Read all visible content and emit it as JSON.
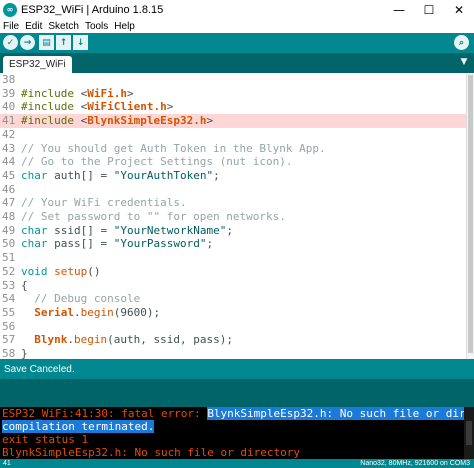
{
  "window": {
    "title": "ESP32_WiFi | Arduino 1.8.15",
    "logo_text": "∞",
    "controls": {
      "minimize": "—",
      "maximize": "☐",
      "close": "✕"
    }
  },
  "menu": [
    "File",
    "Edit",
    "Sketch",
    "Tools",
    "Help"
  ],
  "toolbar": {
    "buttons": [
      {
        "name": "verify",
        "icon": "check-icon",
        "glyph": "✓"
      },
      {
        "name": "upload",
        "icon": "arrow-right-icon",
        "glyph": "→"
      },
      {
        "name": "new",
        "icon": "new-file-icon",
        "glyph": "▤"
      },
      {
        "name": "open",
        "icon": "arrow-up-icon",
        "glyph": "↑"
      },
      {
        "name": "save",
        "icon": "arrow-down-icon",
        "glyph": "↓"
      }
    ],
    "serial_monitor_glyph": "⌕"
  },
  "tabs": [
    {
      "label": "ESP32_WiFi"
    }
  ],
  "tab_menu_glyph": "▼",
  "editor": {
    "highlighted_line": "41",
    "lines": [
      {
        "n": "38",
        "code": ""
      },
      {
        "n": "39",
        "code": "#include <WiFi.h>"
      },
      {
        "n": "40",
        "code": "#include <WiFiClient.h>"
      },
      {
        "n": "41",
        "code": "#include <BlynkSimpleEsp32.h>"
      },
      {
        "n": "42",
        "code": ""
      },
      {
        "n": "43",
        "code": "// You should get Auth Token in the Blynk App."
      },
      {
        "n": "44",
        "code": "// Go to the Project Settings (nut icon)."
      },
      {
        "n": "45",
        "code": "char auth[] = \"YourAuthToken\";"
      },
      {
        "n": "46",
        "code": ""
      },
      {
        "n": "47",
        "code": "// Your WiFi credentials."
      },
      {
        "n": "48",
        "code": "// Set password to \"\" for open networks."
      },
      {
        "n": "49",
        "code": "char ssid[] = \"YourNetworkName\";"
      },
      {
        "n": "50",
        "code": "char pass[] = \"YourPassword\";"
      },
      {
        "n": "51",
        "code": ""
      },
      {
        "n": "52",
        "code": "void setup()"
      },
      {
        "n": "53",
        "code": "{"
      },
      {
        "n": "54",
        "code": "  // Debug console"
      },
      {
        "n": "55",
        "code": "  Serial.begin(9600);"
      },
      {
        "n": "56",
        "code": ""
      },
      {
        "n": "57",
        "code": "  Blynk.begin(auth, ssid, pass);"
      },
      {
        "n": "58",
        "code": "}"
      },
      {
        "n": "59",
        "code": ""
      }
    ]
  },
  "status": {
    "message": "Save Canceled."
  },
  "console": {
    "lines": [
      {
        "segments": [
          {
            "text": "ESP32_WiFi:41:30: fatal error: ",
            "selected": false
          },
          {
            "text": "BlynkSimpleEsp32.h: No such file or directory",
            "selected": true
          }
        ]
      },
      {
        "segments": [
          {
            "text": "compilation terminated.",
            "selected": true
          }
        ]
      },
      {
        "segments": [
          {
            "text": "exit status 1",
            "selected": false
          }
        ]
      },
      {
        "segments": [
          {
            "text": "BlynkSimpleEsp32.h: No such file or directory",
            "selected": false
          }
        ]
      }
    ]
  },
  "footer": {
    "line_number": "41",
    "board_info": "Nano32, 80MHz, 921600 on COM3"
  },
  "colors": {
    "teal": "#00878f",
    "dark_teal": "#006468",
    "error_text": "#e34c00",
    "selection": "#1b7ad8",
    "line_highlight": "#ffd6d6"
  }
}
